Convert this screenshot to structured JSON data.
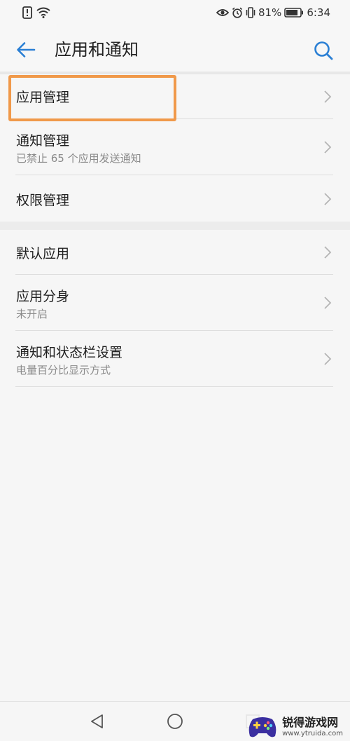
{
  "status_bar": {
    "battery_percent": "81%",
    "time": "6:34",
    "icons": [
      "notification-alert-icon",
      "wifi-icon",
      "eye-icon",
      "alarm-icon",
      "vibrate-icon",
      "battery-icon"
    ]
  },
  "app_bar": {
    "title": "应用和通知",
    "back_icon": "back-arrow-icon",
    "search_icon": "search-icon",
    "accent_color": "#2a7fd4"
  },
  "groups": [
    {
      "items": [
        {
          "title": "应用管理",
          "subtitle": ""
        },
        {
          "title": "通知管理",
          "subtitle": "已禁止 65 个应用发送通知"
        },
        {
          "title": "权限管理",
          "subtitle": ""
        }
      ]
    },
    {
      "items": [
        {
          "title": "默认应用",
          "subtitle": ""
        },
        {
          "title": "应用分身",
          "subtitle": "未开启"
        },
        {
          "title": "通知和状态栏设置",
          "subtitle": "电量百分比显示方式"
        }
      ]
    }
  ],
  "highlight": {
    "target": "应用管理",
    "color": "#f0994a"
  },
  "nav_bar": {
    "buttons": [
      "nav-back-icon",
      "nav-home-icon",
      "nav-recents-icon"
    ]
  },
  "watermark": {
    "title": "锐得游戏网",
    "url": "www.ytruida.com"
  }
}
